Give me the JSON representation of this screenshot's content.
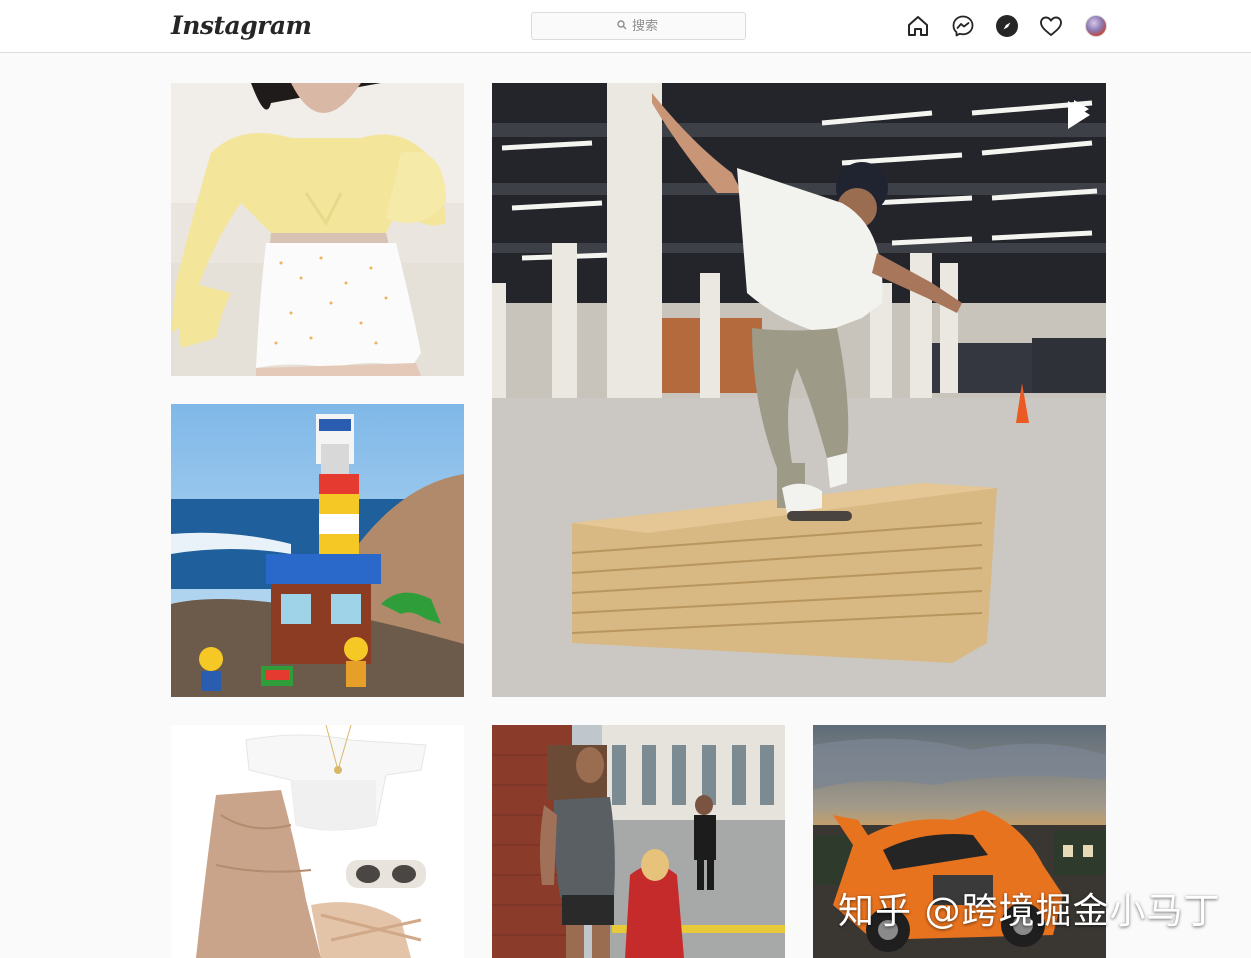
{
  "header": {
    "brand": "Instagram",
    "search": {
      "placeholder": "搜索"
    },
    "nav_icons": [
      "home-icon",
      "messenger-icon",
      "explore-icon",
      "activity-heart-icon",
      "profile-avatar"
    ]
  },
  "grid": {
    "posts": [
      {
        "name": "post-yellow-blouse-outfit",
        "media": "photo"
      },
      {
        "name": "post-skateboarder-video",
        "media": "video"
      },
      {
        "name": "post-lego-lighthouse",
        "media": "photo"
      },
      {
        "name": "post-white-top-skirt-outfit",
        "media": "photo"
      },
      {
        "name": "post-man-and-child-street",
        "media": "photo"
      },
      {
        "name": "post-lego-car-sunset",
        "media": "photo"
      }
    ]
  },
  "watermark": "知乎 @跨境掘金小马丁",
  "colors": {
    "background": "#fafafa",
    "header_border": "#dbdbdb",
    "icon": "#262626"
  }
}
